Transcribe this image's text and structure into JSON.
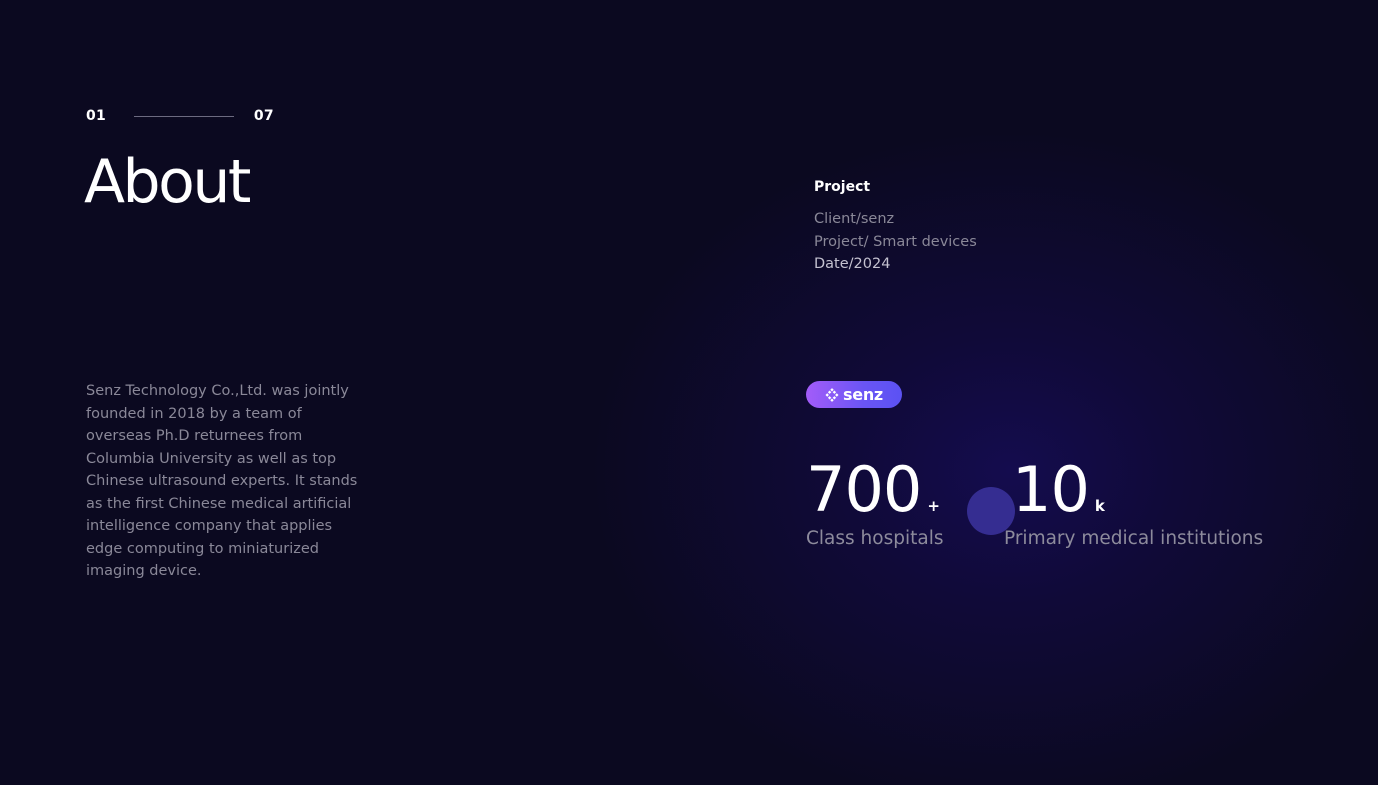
{
  "pager": {
    "current": "01",
    "total": "07"
  },
  "section_title": "About",
  "description": "Senz Technology Co.,Ltd. was jointly founded in 2018 by a team of overseas Ph.D returnees from Columbia University as well as top Chinese ultrasound experts. It stands as the first Chinese medical artificial intelligence company that applies edge computing to miniaturized imaging device.",
  "project": {
    "heading": "Project",
    "client": "Client/senz",
    "project": "Project/ Smart devices",
    "date": "Date/2024"
  },
  "logo": {
    "icon": "senz-diamond-icon",
    "wordmark": "senz",
    "gradient": [
      "#a35cf8",
      "#5b52f3"
    ]
  },
  "stats": [
    {
      "value": "700",
      "suffix": "+",
      "label": "Class hospitals"
    },
    {
      "value": "10",
      "suffix": "k",
      "label": "Primary medical institutions"
    }
  ],
  "colors": {
    "background": "#0b0920",
    "glow": "#140c4e",
    "cursor": "#352d91",
    "muted_text": "#8a8898"
  }
}
